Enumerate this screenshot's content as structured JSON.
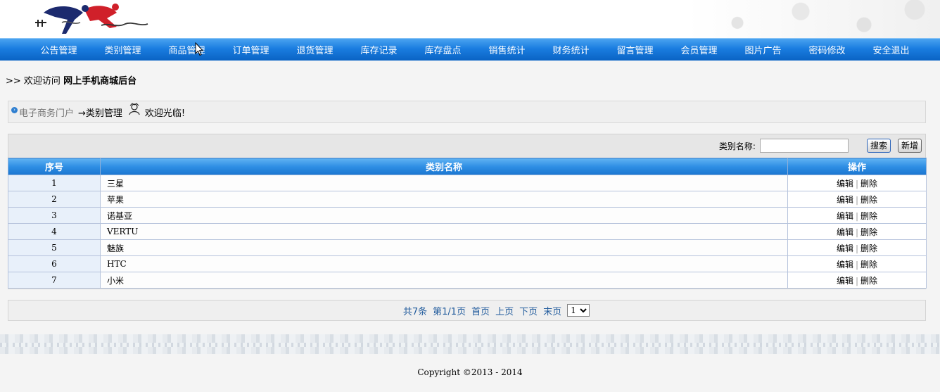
{
  "nav": {
    "items": [
      "公告管理",
      "类别管理",
      "商品管理",
      "订单管理",
      "退货管理",
      "库存记录",
      "库存盘点",
      "销售统计",
      "财务统计",
      "留言管理",
      "会员管理",
      "图片广告",
      "密码修改",
      "安全退出"
    ]
  },
  "welcome": {
    "prefix": ">> 欢迎访问",
    "site": "网上手机商城后台"
  },
  "breadcrumb": {
    "home": "电子商务门户",
    "current": "→类别管理",
    "greeting": "欢迎光临!"
  },
  "search": {
    "label": "类别名称:",
    "value": "",
    "search_button": "搜索",
    "add_button": "新增"
  },
  "table": {
    "headers": [
      "序号",
      "类别名称",
      "操作"
    ],
    "rows": [
      {
        "index": "1",
        "name": "三星"
      },
      {
        "index": "2",
        "name": "苹果"
      },
      {
        "index": "3",
        "name": "诺基亚"
      },
      {
        "index": "4",
        "name": "VERTU"
      },
      {
        "index": "5",
        "name": "魅族"
      },
      {
        "index": "6",
        "name": "HTC"
      },
      {
        "index": "7",
        "name": "小米"
      }
    ],
    "edit_label": "编辑",
    "delete_label": "删除"
  },
  "pager": {
    "total": "共7条",
    "page": "第1/1页",
    "first": "首页",
    "prev": "上页",
    "next": "下页",
    "last": "末页",
    "selected_page": "1"
  },
  "footer": {
    "copyright": "Copyright ©2013 - 2014"
  },
  "colors": {
    "nav_bg": "#1a7de0",
    "header_th": "#2e8ee4",
    "link_blue": "#1f5a9c"
  }
}
